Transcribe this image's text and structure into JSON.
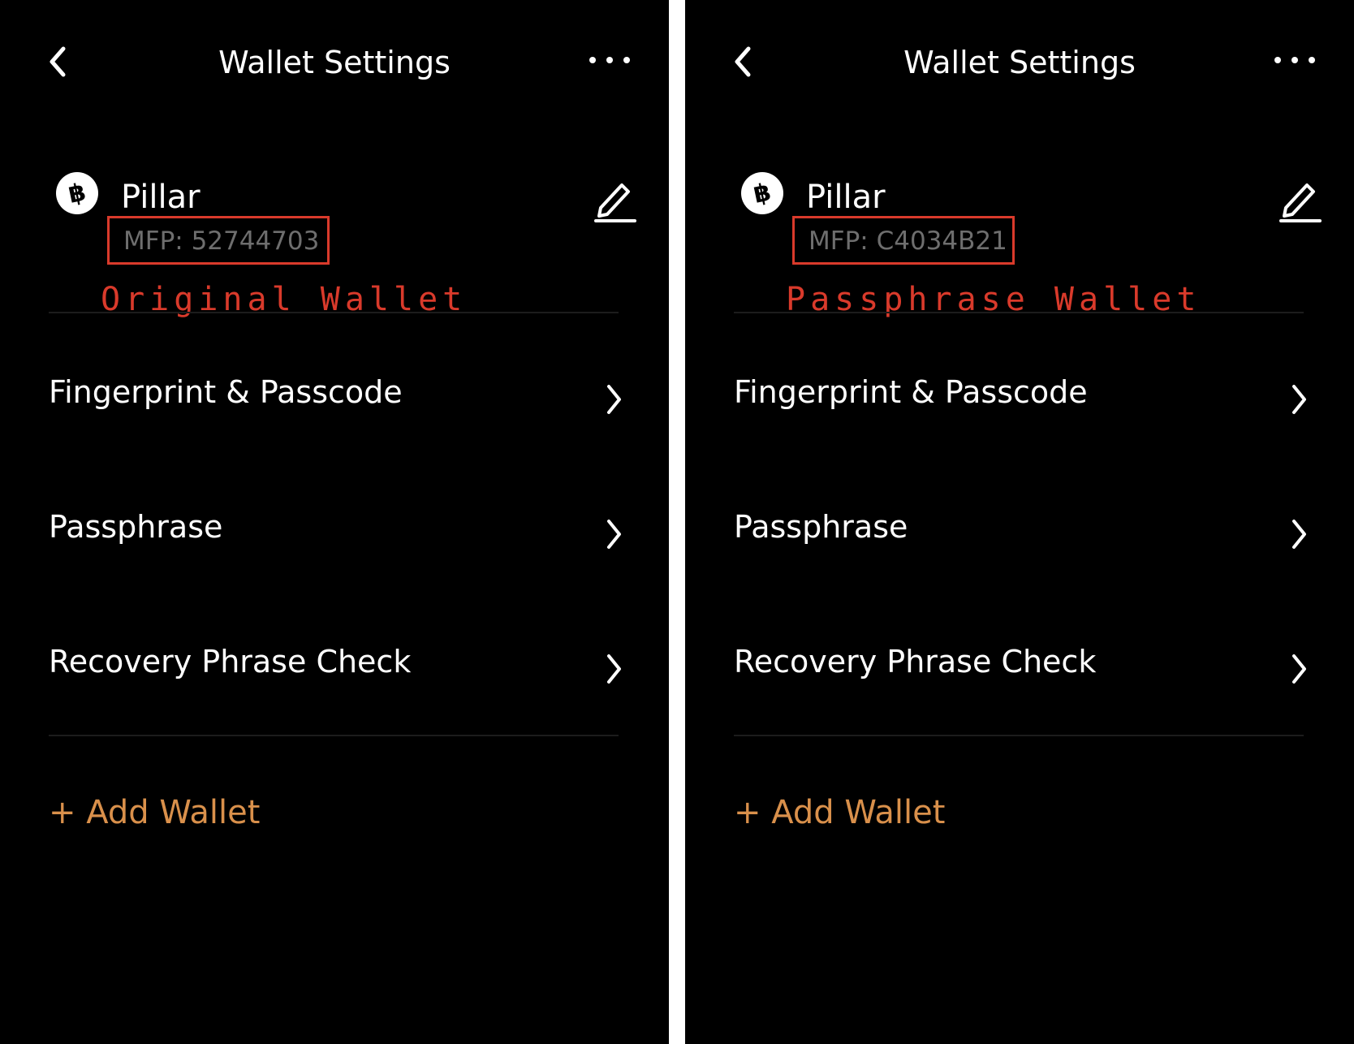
{
  "colors": {
    "background": "#000000",
    "separator": "#ffffff",
    "text": "#ffffff",
    "muted_text": "#6e6e6e",
    "highlight_red": "#d93a2b",
    "accent_orange": "#d9904b"
  },
  "icons": {
    "back": "chevron-left-icon",
    "more": "more-horizontal-icon",
    "coin": "bitcoin-icon",
    "edit": "pencil-icon",
    "row_chevron": "chevron-right-icon"
  },
  "panels": [
    {
      "header": {
        "title": "Wallet Settings"
      },
      "wallet": {
        "name": "Pillar",
        "mfp": "MFP: 52744703",
        "annotation": "Original Wallet"
      },
      "menu": [
        {
          "label": "Fingerprint & Passcode"
        },
        {
          "label": "Passphrase"
        },
        {
          "label": "Recovery Phrase Check"
        }
      ],
      "add_wallet": "+ Add Wallet"
    },
    {
      "header": {
        "title": "Wallet Settings"
      },
      "wallet": {
        "name": "Pillar",
        "mfp": "MFP: C4034B21",
        "annotation": "Passphrase Wallet"
      },
      "menu": [
        {
          "label": "Fingerprint & Passcode"
        },
        {
          "label": "Passphrase"
        },
        {
          "label": "Recovery Phrase Check"
        }
      ],
      "add_wallet": "+ Add Wallet"
    }
  ]
}
